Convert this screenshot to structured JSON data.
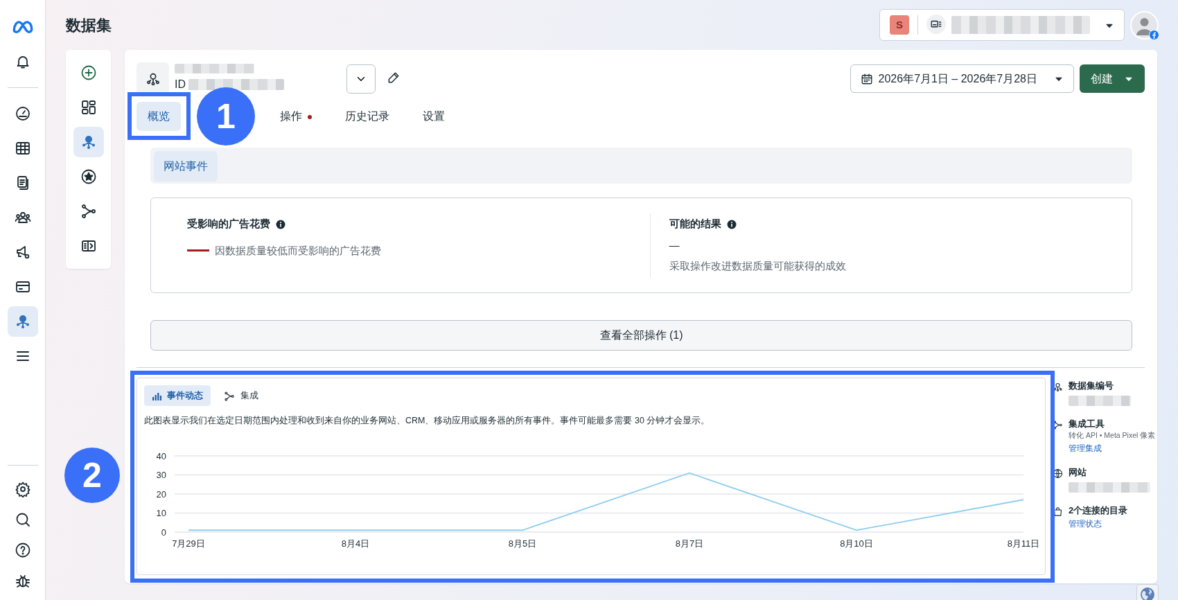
{
  "rail": {
    "top_items": [
      {
        "kind": "bell",
        "selected": false
      },
      {
        "kind": "gauge",
        "selected": false
      },
      {
        "kind": "table",
        "selected": false
      },
      {
        "kind": "docs",
        "selected": false
      },
      {
        "kind": "people",
        "selected": false
      },
      {
        "kind": "megaphone",
        "selected": false
      },
      {
        "kind": "card",
        "selected": false
      },
      {
        "kind": "dataset",
        "selected": true
      },
      {
        "kind": "menu",
        "selected": false
      }
    ],
    "bottom_items": [
      {
        "kind": "gear",
        "selected": false
      },
      {
        "kind": "search",
        "selected": false
      },
      {
        "kind": "help",
        "selected": false
      },
      {
        "kind": "bug",
        "selected": false
      }
    ]
  },
  "page_title": "数据集",
  "account": {
    "initial": "S"
  },
  "side_tools": [
    {
      "kind": "add",
      "selected": false
    },
    {
      "kind": "grid",
      "selected": false
    },
    {
      "kind": "dataset",
      "selected": true
    },
    {
      "kind": "star",
      "selected": false
    },
    {
      "kind": "flow",
      "selected": false
    },
    {
      "kind": "panel",
      "selected": false
    }
  ],
  "dataset": {
    "id_label": "ID"
  },
  "date_range": "2026年7月1日 – 2026年7月28日",
  "create_button": "创建",
  "tabs": [
    {
      "label": "概览",
      "selected": true,
      "alert": false
    },
    {
      "label": "操作",
      "selected": false,
      "alert": true
    },
    {
      "label": "历史记录",
      "selected": false,
      "alert": false
    },
    {
      "label": "设置",
      "selected": false,
      "alert": false
    }
  ],
  "sub_tabs": [
    {
      "label": "网站事件",
      "selected": true
    }
  ],
  "metrics": [
    {
      "title": "受影响的广告花费",
      "legend": true,
      "description": "因数据质量较低而受影响的广告花费"
    },
    {
      "title": "可能的结果",
      "value": "—",
      "legend": false,
      "description": "采取操作改进数据质量可能获得的成效"
    }
  ],
  "view_all_button": "查看全部操作 (1)",
  "chart_tabs": [
    {
      "label": "事件动态",
      "kind": "bars",
      "selected": true
    },
    {
      "label": "集成",
      "kind": "flow",
      "selected": false
    }
  ],
  "chart_description": "此图表显示我们在选定日期范围内处理和收到来自你的业务网站、CRM、移动应用或服务器的所有事件。事件可能最多需要 30 分钟才会显示。",
  "chart_data": {
    "type": "line",
    "categories": [
      "7月29日",
      "8月4日",
      "8月5日",
      "8月7日",
      "8月10日",
      "8月11日"
    ],
    "series": [
      {
        "color": "#8ecdf0",
        "values": [
          1,
          1,
          1,
          31,
          1,
          17
        ]
      }
    ],
    "ylim": [
      0,
      40
    ],
    "grid": true,
    "yticks": [
      0,
      10,
      20,
      30,
      40
    ]
  },
  "info_panel": [
    {
      "kind": "dataset",
      "title": "数据集编号",
      "blurred": true
    },
    {
      "kind": "flow",
      "title": "集成工具",
      "detail": "转化 API • Meta Pixel 像素",
      "link": "管理集成",
      "blurred": false
    },
    {
      "kind": "globe",
      "title": "网站",
      "blurred": true
    },
    {
      "kind": "bag",
      "title": "2个连接的目录",
      "link": "管理状态",
      "blurred": false
    }
  ],
  "annotations": [
    {
      "label": "1"
    },
    {
      "label": "2"
    }
  ]
}
